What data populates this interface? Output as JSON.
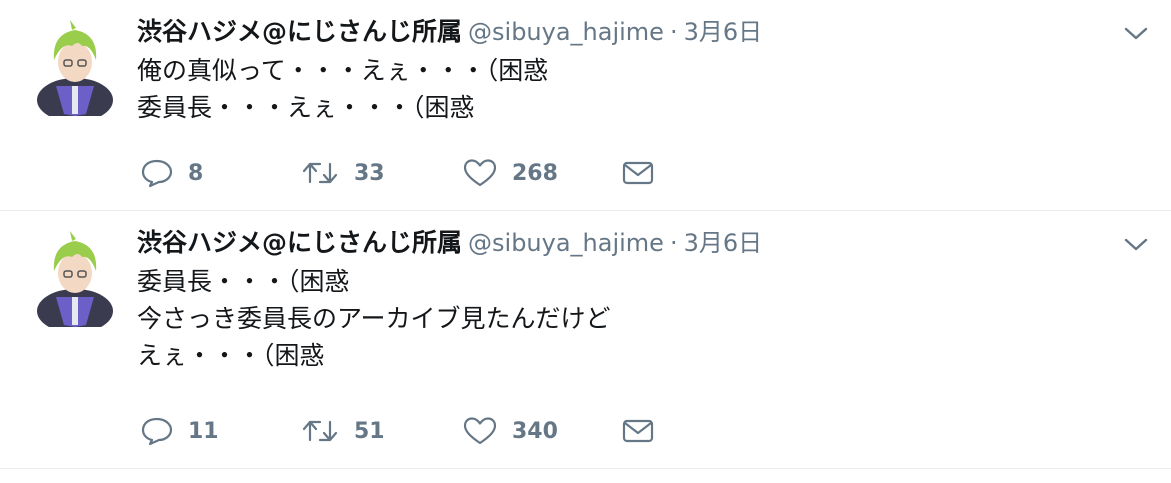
{
  "tweets": [
    {
      "name": "渋谷ハジメ@にじさんじ所属",
      "handle": "@sibuya_hajime",
      "separator": "·",
      "date": "3月6日",
      "lines": [
        "俺の真似って・・・えぇ・・・（困惑",
        "委員長・・・えぇ・・・（困惑"
      ],
      "replies": "8",
      "retweets": "33",
      "likes": "268"
    },
    {
      "name": "渋谷ハジメ@にじさんじ所属",
      "handle": "@sibuya_hajime",
      "separator": "·",
      "date": "3月6日",
      "lines": [
        "委員長・・・（困惑",
        "今さっき委員長のアーカイブ見たんだけど",
        "えぇ・・・（困惑"
      ],
      "replies": "11",
      "retweets": "51",
      "likes": "340"
    }
  ],
  "icons": {
    "reply": "reply-icon",
    "retweet": "retweet-icon",
    "like": "like-icon",
    "dm": "mail-icon",
    "more": "chevron-down-icon"
  },
  "colors": {
    "name": "#14171a",
    "meta": "#657786",
    "icon": "#657786",
    "divider": "#e6ecf0",
    "avatar_hair": "#9acd4c",
    "avatar_hoodie": "#3b3b4f",
    "avatar_accent": "#6c5fc7"
  }
}
